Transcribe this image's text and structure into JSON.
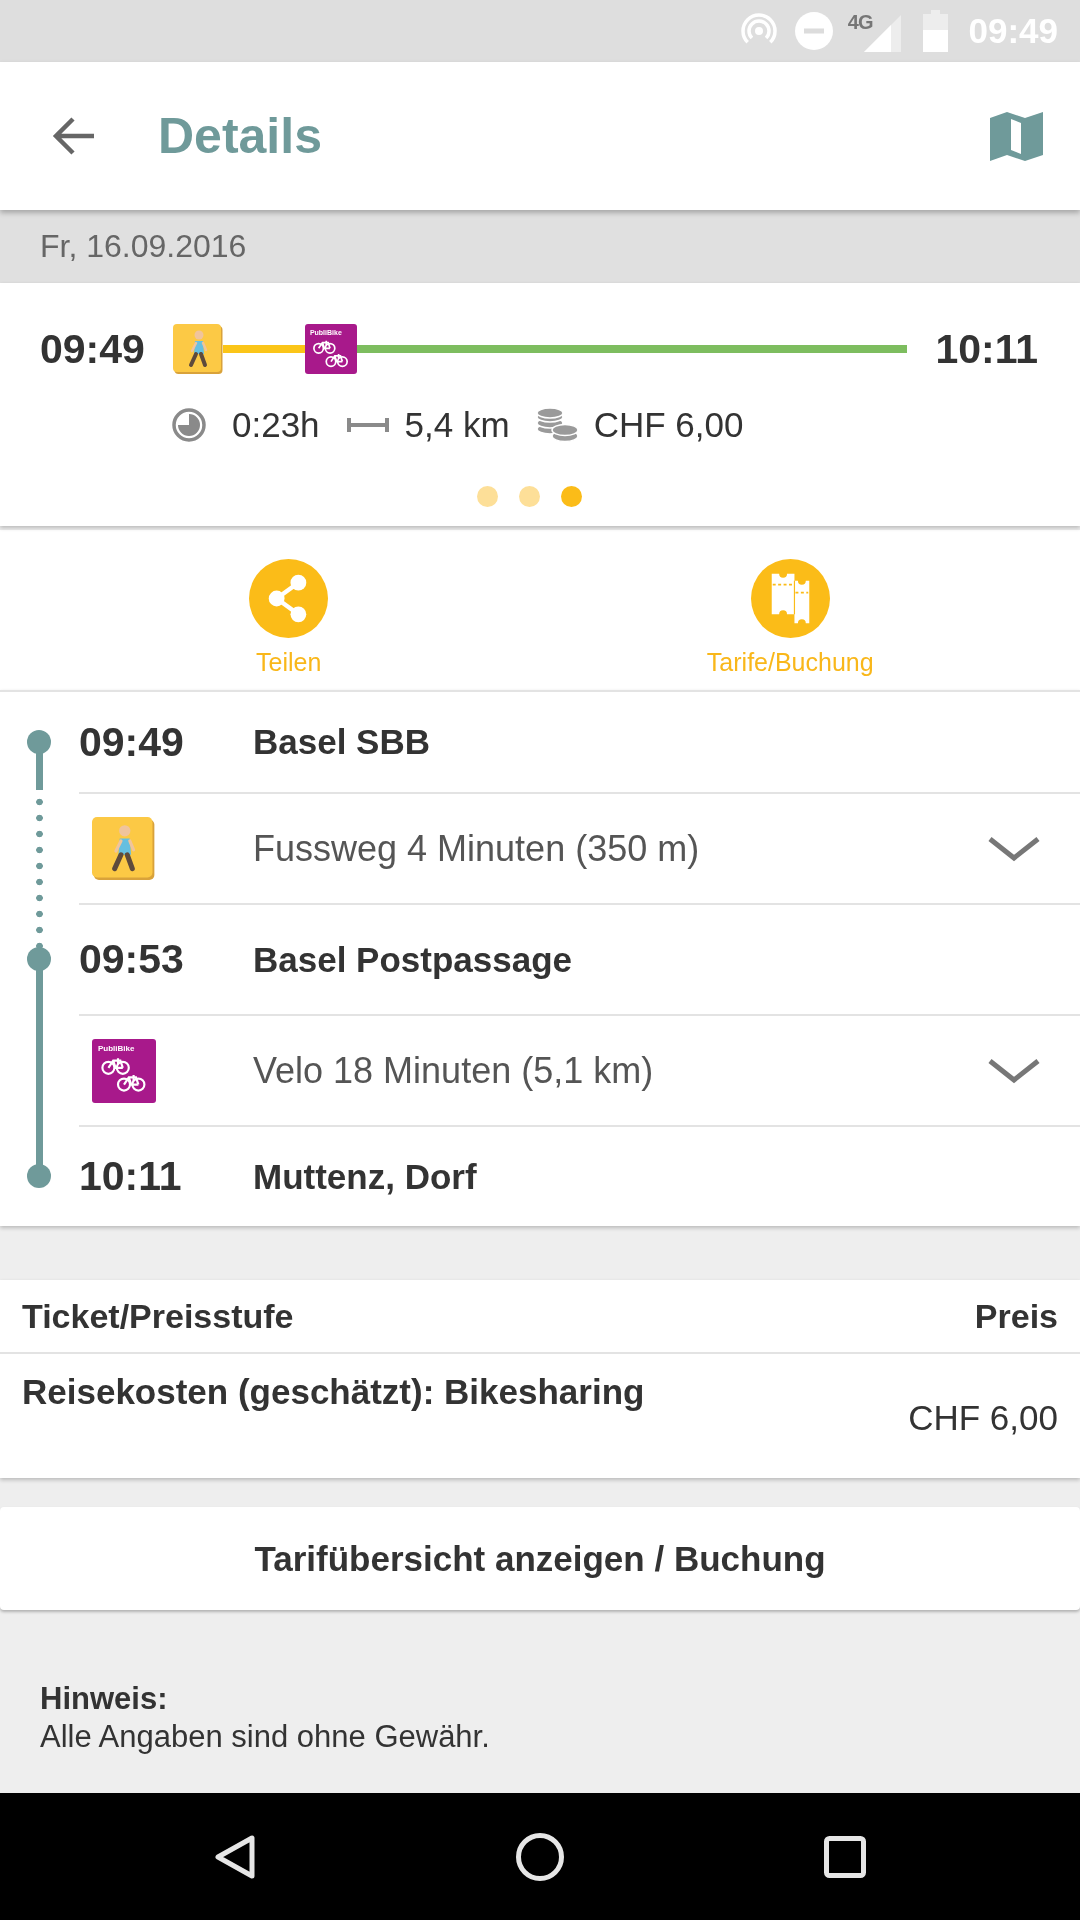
{
  "status_bar": {
    "network": "4G",
    "time": "09:49"
  },
  "app_bar": {
    "title": "Details"
  },
  "date": "Fr, 16.09.2016",
  "summary": {
    "departure": "09:49",
    "segments": [
      {
        "kind": "walk",
        "color": "#fbc518"
      },
      {
        "kind": "bike",
        "logo_text": "PubliBike",
        "color": "#7dbd5f"
      }
    ],
    "arrival": "10:11",
    "duration": "0:23h",
    "distance": "5,4 km",
    "price": "CHF 6,00",
    "pages": [
      {
        "selected": false
      },
      {
        "selected": false
      },
      {
        "selected": true
      }
    ]
  },
  "actions": [
    {
      "kind": "share",
      "label": "Teilen"
    },
    {
      "kind": "fares",
      "label": "Tarife/Buchung"
    }
  ],
  "itinerary": [
    {
      "kind": "stop",
      "time": "09:49",
      "name": "Basel SBB"
    },
    {
      "kind": "walk",
      "text": "Fussweg 4 Minuten (350 m)",
      "expanded": false
    },
    {
      "kind": "stop",
      "time": "09:53",
      "name": "Basel Postpassage"
    },
    {
      "kind": "bike",
      "logo_text": "PubliBike",
      "text": "Velo 18 Minuten (5,1 km)",
      "expanded": false
    },
    {
      "kind": "stop",
      "time": "10:11",
      "name": "Muttenz, Dorf"
    }
  ],
  "tickets": {
    "columns": [
      "Ticket/Preisstufe",
      "Preis"
    ],
    "rows": [
      {
        "ticket": "Reisekosten (geschätzt): Bikesharing",
        "price": "CHF 6,00"
      }
    ]
  },
  "tariff_button": "Tarifübersicht anzeigen / Buchung",
  "note": {
    "title": "Hinweis:",
    "text": "Alle Angaben sind ohne Gewähr."
  }
}
